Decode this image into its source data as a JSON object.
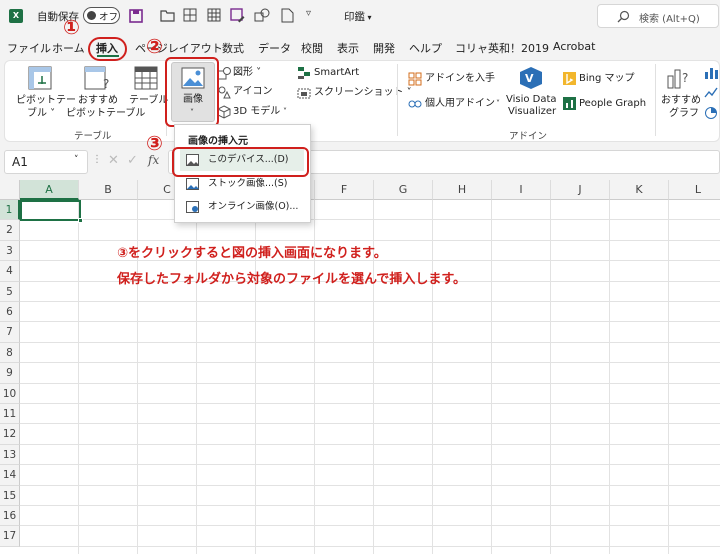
{
  "titlebar": {
    "excel_icon_letter": "X",
    "autosave_label": "自動保存",
    "autosave_state": "オフ",
    "print_menu": "印鑑",
    "search_placeholder": "検索 (Alt+Q)"
  },
  "menu": {
    "tabs": [
      "ファイル",
      "ホーム",
      "挿入",
      "ページレイアウト",
      "数式",
      "データ",
      "校閲",
      "表示",
      "開発",
      "ヘルプ",
      "コリャ英和！2019",
      "Acrobat"
    ],
    "active_tab": "挿入"
  },
  "ribbon": {
    "pivot_table": [
      "ピボットテー",
      "ブル ˅"
    ],
    "recommended_pivot": [
      "おすすめ",
      "ピボットテーブル"
    ],
    "table": "テーブル",
    "group_table": "テーブル",
    "picture": "画像",
    "shapes": "図形 ˅",
    "icons": "アイコン",
    "models_3d": "3D モデル",
    "smartart": "SmartArt",
    "screenshot": "スクリーンショット ˅",
    "get_addins": "アドインを入手",
    "personal_addins": "個人用アドイン",
    "visio": [
      "Visio Data",
      "Visualizer"
    ],
    "bing_maps": "Bing マップ",
    "people_graph": "People Graph",
    "group_addins": "アドイン",
    "recommended_charts": [
      "おすすめ",
      "グラフ"
    ]
  },
  "formula_bar": {
    "name_box": "A1",
    "fx": "fx",
    "formula": ""
  },
  "dropdown": {
    "title": "画像の挿入元",
    "items": [
      "このデバイス...(D)",
      "ストック画像...(S)",
      "オンライン画像(O)..."
    ]
  },
  "grid": {
    "columns": [
      "A",
      "B",
      "C",
      "D",
      "E",
      "F",
      "G",
      "H",
      "I",
      "J",
      "K",
      "L"
    ],
    "rows": [
      "1",
      "2",
      "3",
      "4",
      "5",
      "6",
      "7",
      "8",
      "9",
      "10",
      "11",
      "12",
      "13",
      "14",
      "15",
      "16",
      "17"
    ]
  },
  "annotations": {
    "step1": "①",
    "step2": "②",
    "step3": "③",
    "line1": "③をクリックすると図の挿入画面になります。",
    "line2": "保存したフォルダから対象のファイルを選んで挿入します。"
  },
  "colors": {
    "excel_green": "#1e7145",
    "annotation_red": "#d0201d",
    "save_purple": "#7a2b8f"
  }
}
